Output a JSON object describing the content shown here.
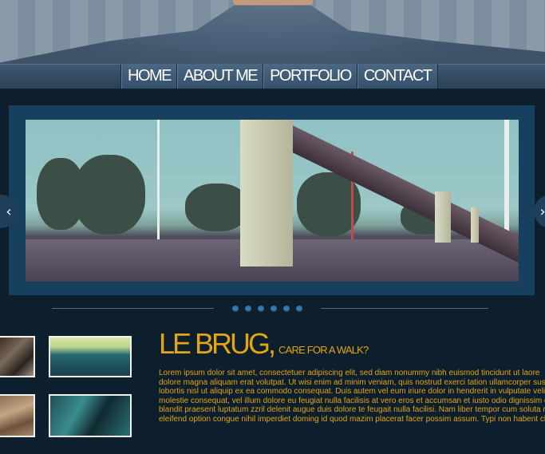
{
  "nav": {
    "items": [
      {
        "label": "HOME"
      },
      {
        "label": "ABOUT ME"
      },
      {
        "label": "PORTFOLIO"
      },
      {
        "label": "CONTACT"
      }
    ]
  },
  "slider": {
    "prev_icon": "chevron-left-icon",
    "next_icon": "chevron-right-icon",
    "prev_glyph": "‹",
    "next_glyph": "›",
    "slide_count": 6,
    "dot_color": "#2d7db5"
  },
  "article": {
    "title": "LE BRUG,",
    "subtitle": "CARE FOR A WALK?",
    "lines": [
      "Lorem ipsum dolor sit amet, consectetuer adipiscing elit, sed diam nonummy nibh euismod tincidunt ut laore",
      "dolore magna aliquam erat volutpat. Ut wisi enim ad minim veniam, quis nostrud exerci tation ullamcorper suscip",
      "lobortis nisl ut aliquip ex ea commodo consequat. Duis autem vel eum iriure dolor in hendrerit in vulputate velit es",
      "molestie consequat, vel illum dolore eu feugiat nulla facilisis at vero eros et accumsan et iusto odio dignissim q",
      "blandit praesent luptatum zzril delenit augue duis dolore te feugait nulla facilisi. Nam liber tempor cum soluta nob",
      "eleifend option congue nihil imperdiet doming id quod mazim placerat facer possim assum. Typi non habent clarita"
    ]
  },
  "colors": {
    "accent": "#e2a515",
    "background": "#0d1e2c",
    "frame": "#17405f"
  }
}
